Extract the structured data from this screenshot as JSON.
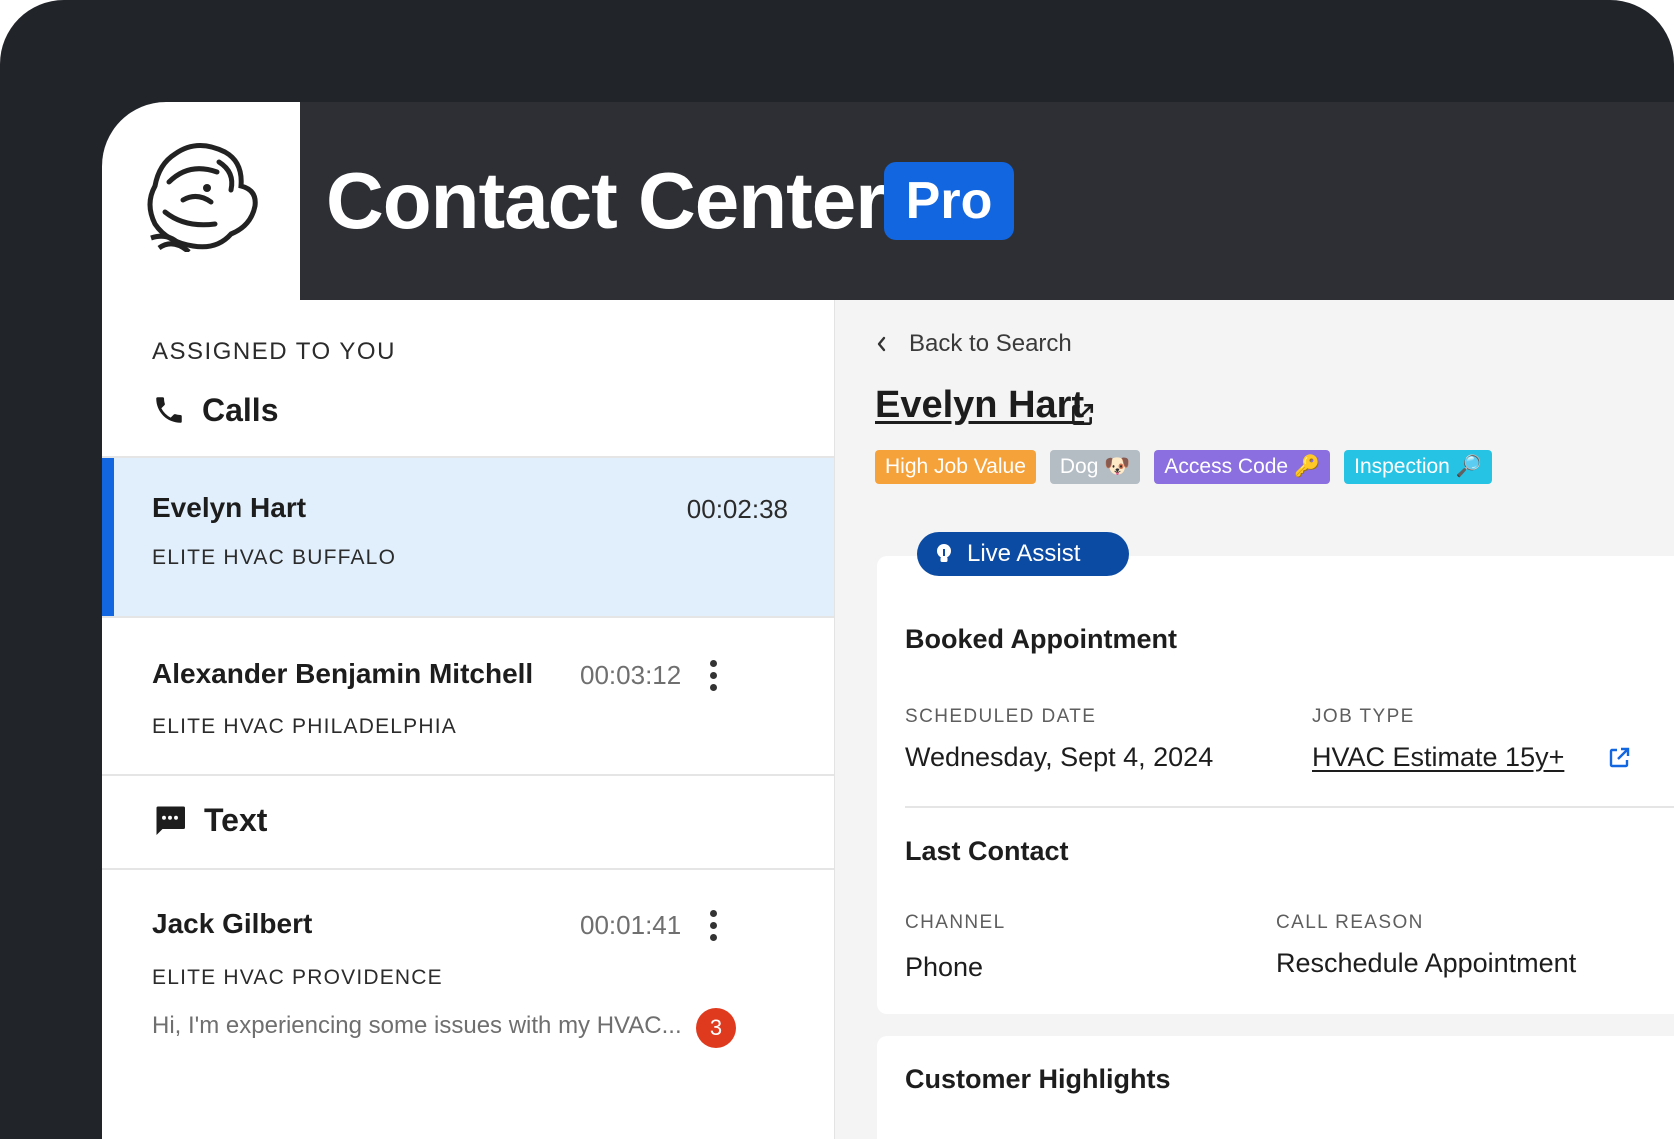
{
  "header": {
    "title": "Contact Center",
    "badge": "Pro"
  },
  "sidebar": {
    "section_label": "ASSIGNED TO YOU",
    "calls_label": "Calls",
    "text_label": "Text",
    "calls": [
      {
        "name": "Evelyn Hart",
        "time": "00:02:38",
        "org": "ELITE HVAC BUFFALO"
      },
      {
        "name": "Alexander Benjamin Mitchell",
        "time": "00:03:12",
        "org": "ELITE HVAC PHILADELPHIA"
      }
    ],
    "texts": [
      {
        "name": "Jack Gilbert",
        "time": "00:01:41",
        "org": "ELITE HVAC PROVIDENCE",
        "preview": "Hi, I'm experiencing some issues with my HVAC...",
        "unread": "3"
      }
    ]
  },
  "detail": {
    "back_label": "Back to Search",
    "contact_name": "Evelyn Hart",
    "tags": [
      {
        "label": "High Job Value",
        "color": "#f5a23a"
      },
      {
        "label": "Dog 🐶",
        "color": "#b4bcc4"
      },
      {
        "label": "Access Code 🔑",
        "color": "#8b6fe0"
      },
      {
        "label": "Inspection 🔎",
        "color": "#27c3e4"
      }
    ],
    "live_assist": "Live Assist",
    "booked": {
      "title": "Booked Appointment",
      "scheduled_label": "SCHEDULED DATE",
      "scheduled_value": "Wednesday, Sept 4, 2024",
      "job_type_label": "JOB TYPE",
      "job_type_value": "HVAC Estimate  15y+"
    },
    "last_contact": {
      "title": "Last Contact",
      "channel_label": "CHANNEL",
      "channel_value": "Phone",
      "reason_label": "CALL REASON",
      "reason_value": "Reschedule Appointment"
    },
    "highlights_title": "Customer Highlights"
  },
  "colors": {
    "accent": "#1266e0",
    "live_assist": "#0c4ba3",
    "unread": "#e03a1e"
  }
}
